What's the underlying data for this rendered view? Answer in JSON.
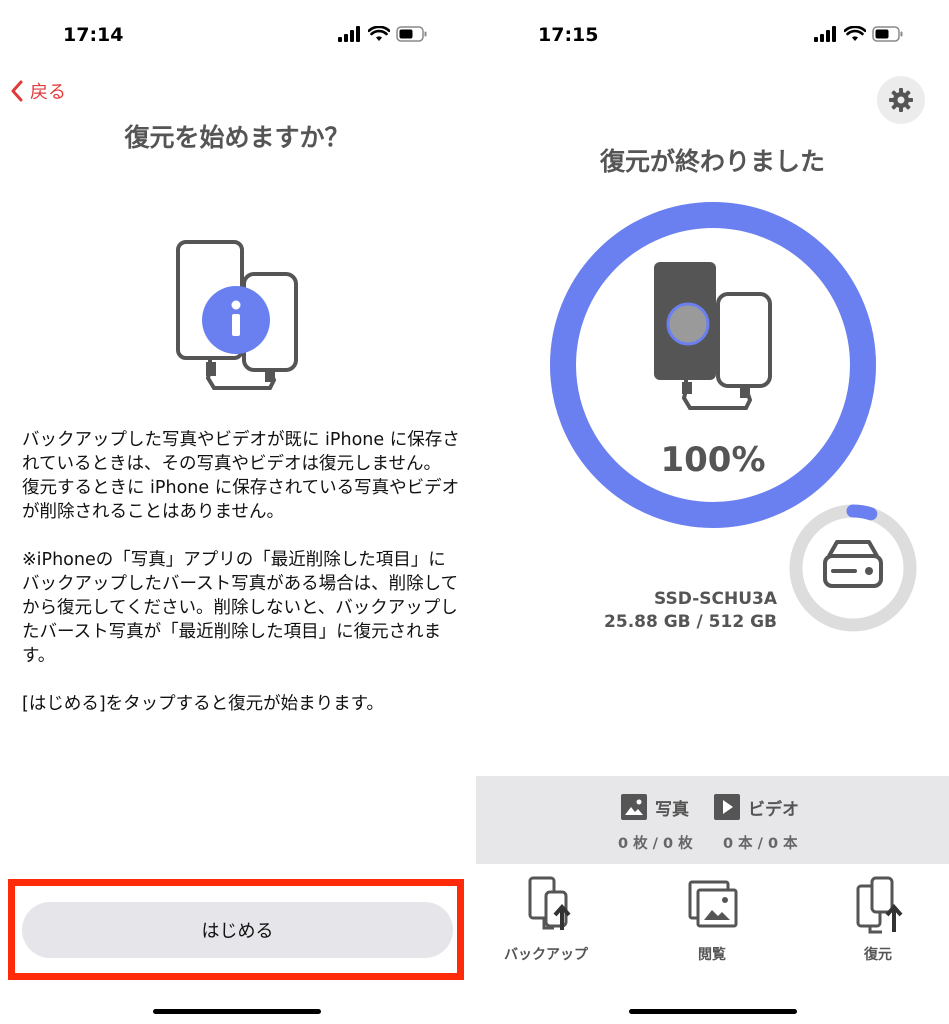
{
  "left_screen": {
    "status": {
      "time": "17:14"
    },
    "back_label": "戻る",
    "title": "復元を始めますか？",
    "paragraphs": [
      "バックアップした写真やビデオが既に iPhone に保存されているときは、その写真やビデオは復元しません。\n復元するときに iPhone に保存されている写真やビデオが削除されることはありません。",
      "※iPhoneの「写真」アプリの「最近削除した項目」にバックアップしたバースト写真がある場合は、削除してから復元してください。削除しないと、バックアップしたバースト写真が「最近削除した項目」に復元されます。",
      "[はじめる]をタップすると復元が始まります。"
    ],
    "start_button_label": "はじめる"
  },
  "right_screen": {
    "status": {
      "time": "17:15"
    },
    "title": "復元が終わりました",
    "progress": {
      "label": "100%",
      "fraction": 1.0
    },
    "storage": {
      "device_name": "SSD-SCHU3A",
      "usage_label": "25.88 GB / 512 GB",
      "fraction": 0.0505
    },
    "summary": {
      "photos_label": "写真",
      "photos_count": "0 枚 / 0 枚",
      "videos_label": "ビデオ",
      "videos_count": "0 本 / 0 本"
    },
    "tabs": [
      {
        "label": "バックアップ",
        "icon": "backup-icon"
      },
      {
        "label": "閲覧",
        "icon": "browse-icon"
      },
      {
        "label": "復元",
        "icon": "restore-icon"
      }
    ]
  },
  "colors": {
    "accent_blue": "#6b80f0",
    "back_red": "#e23a3a",
    "highlight_red": "#ff2a0a",
    "ring_gray": "#dddddd"
  }
}
